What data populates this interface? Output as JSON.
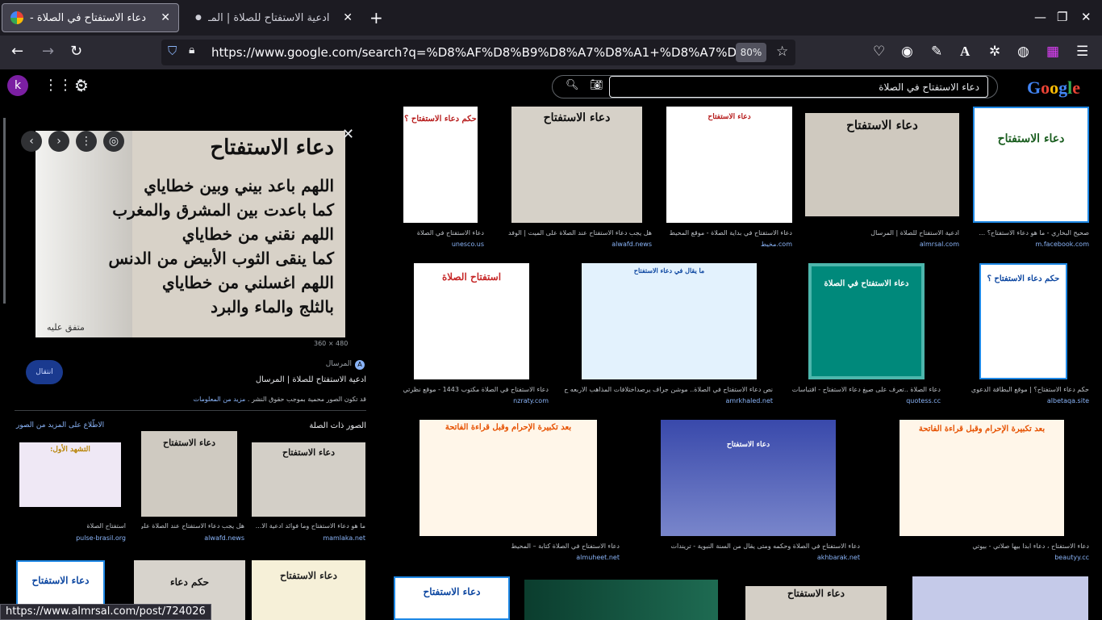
{
  "tabs": [
    {
      "title": "دعاء الاستفتاح في الصلاة -",
      "close": "✕"
    },
    {
      "title": "ادعية الاستفتاح للصلاة | المـ",
      "close": "✕"
    }
  ],
  "new_tab": "+",
  "window": {
    "minimize": "—",
    "restore": "❐",
    "close": "✕"
  },
  "nav": {
    "back": "←",
    "forward": "→",
    "reload": "↻"
  },
  "address": {
    "url": "https://www.google.com/search?q=%D8%AF%D8%B9%D8%A7%D8%A1+%D8%A7%D9%84",
    "zoom": "80%"
  },
  "google": {
    "avatar": "k",
    "logo": [
      "G",
      "o",
      "o",
      "g",
      "l",
      "e"
    ],
    "query": "دعاء الاستفتاح في الصلاة"
  },
  "preview": {
    "lines": [
      "دعاء الاستفتاح",
      "اللهم باعد بيني وبين خطاياي",
      "كما باعدت بين المشرق والمغرب",
      "اللهم نقني من خطاياي",
      "كما ينقى الثوب الأبيض من الدنس",
      "اللهم اغسلني من خطاياي",
      "بالثلج والماء والبرد"
    ],
    "footnote": "متفق عليه",
    "dims": "360 × 480",
    "source": "المرسال",
    "visit": "انتقال",
    "title": "ادعية الاستفتاح للصلاة | المرسال",
    "note_text": "قد تكون الصور محمية بموجب حقوق النشر .",
    "note_link": "مزيد من المعلومات",
    "related_heading": "الصور ذات الصلة",
    "related_more": "الاطّلاع على المزيد من الصور",
    "related": [
      {
        "title": "ما هو دعاء الاستفتاح وما فوائد ادعية الا...",
        "source": "mamlaka.net",
        "img": "دعاء الاستفتاح"
      },
      {
        "title": "هل يجب دعاء الاستفتاح عند الصلاة على...",
        "source": "alwafd.news",
        "img": "دعاء الاستفتاح"
      },
      {
        "title": "استفتاح الصلاة",
        "source": "pulse-brasil.org",
        "img": "التشهد الأول:"
      }
    ]
  },
  "results": [
    {
      "title": "صحيح البخاري - ما هو دعاء الاستفتاح؟ ...",
      "source": "m.facebook.com",
      "img": "دعاء الاستفتاح"
    },
    {
      "title": "ادعية الاستفتاح للصلاة | المرسال",
      "source": "almrsal.com",
      "img": "دعاء الاستفتاح"
    },
    {
      "title": "دعاء الاستفتاح في بداية الصلاة - موقع المحيط",
      "source": "مخيط.com",
      "img": "دعاء الاستفتاح"
    },
    {
      "title": "هل يجب دعاء الاستفتاح عند الصلاة على الميت | الوفد",
      "source": "alwafd.news",
      "img": "دعاء الاستفتاح"
    },
    {
      "title": "دعاء الاستفتاح في الصلاة",
      "source": "unesco.us",
      "img": "حكم دعاء الاستفتاح ؟"
    },
    {
      "title": "حكم دعاء الاستفتاح؟ | موقع البطاقة الدعوي",
      "source": "albetaqa.site",
      "img": "حكم دعاء الاستفتاح ؟"
    },
    {
      "title": "دعاء الصلاة ..تعرف على صيغ دعاء الاستفتاح - اقتباسات",
      "source": "quotess.cc",
      "img": "دعاء الاستفتاح في الصلاة"
    },
    {
      "title": "نص دعاء الاستفتاح في الصلاة.. موشن جراف يرصداختلافات المذاهب الاربعه ح...",
      "source": "amrkhaled.net",
      "img": "ما يقال في دعاء الاستفتاح"
    },
    {
      "title": "دعاء الاستفتاح في الصلاة مكتوب 1443 - موقع نظرتي",
      "source": "nzraty.com",
      "img": "استفتاح الصلاة"
    },
    {
      "title": "دعاء الاستفتاح ، دعاء ابدا بيها صلاتي - بيوتي",
      "source": "beautyy.cc",
      "img": "بعد تكبيرة الإحرام وقبل قراءة الفاتحة"
    },
    {
      "title": "دعاء الاستفتاح في الصلاة وحكمه ومتى يقال من السنة النبوية - تريندات",
      "source": "akhbarak.net",
      "img": "دعاء الاستفتاح"
    },
    {
      "title": "دعاء الاستفتاح في الصلاة كتابة – المحيط",
      "source": "almuheet.net",
      "img": "بعد تكبيرة الإحرام وقبل قراءة الفاتحة"
    }
  ],
  "bottom_row": [
    {
      "img": "دعاء الاستفتاح"
    },
    {
      "img": "دعاء الاستفتاح"
    },
    {
      "img": ""
    },
    {
      "img": "حكم دعاء"
    },
    {
      "img": "دعاء الاستفتاح"
    },
    {
      "img": "دعاء الاستفتاح"
    }
  ],
  "status_url": "https://www.almrsal.com/post/724026"
}
